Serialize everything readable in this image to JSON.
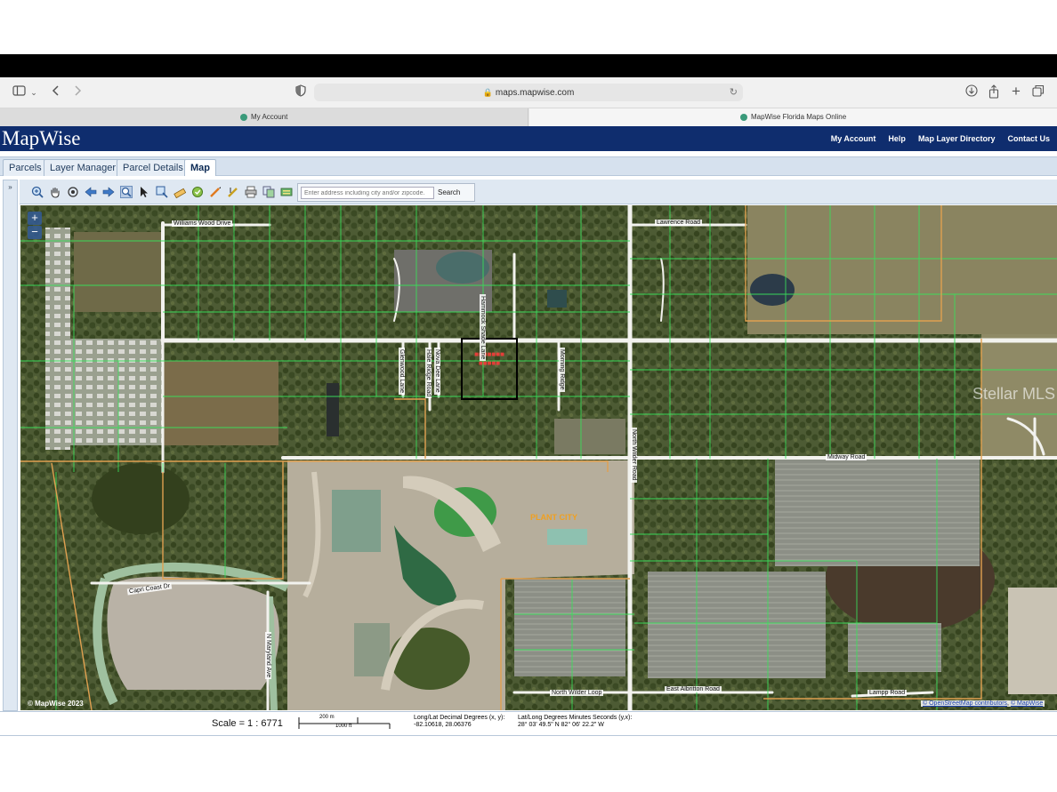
{
  "browser": {
    "url": "maps.mapwise.com",
    "tabs": [
      {
        "label": "My Account"
      },
      {
        "label": "MapWise Florida Maps Online"
      }
    ]
  },
  "header": {
    "logo": "MapWise",
    "nav": [
      "My Account",
      "Help",
      "Map Layer Directory",
      "Contact Us"
    ]
  },
  "app_tabs": [
    "Parcels",
    "Layer Manager",
    "Parcel Details",
    "Map"
  ],
  "active_tab": "Map",
  "side_toggle": "»",
  "search": {
    "placeholder": "Enter address including city and/or zipcode.",
    "button": "Search"
  },
  "map": {
    "zoom_in": "+",
    "zoom_out": "−",
    "roads": {
      "williams_wood": "Williams Wood Drive",
      "lawrence": "Lawrence Road",
      "hammock": "Hammock Shade Lane",
      "north_wilder": "North Wilder Road",
      "midway": "Midway Road",
      "capri": "Capri Coast Dr",
      "n_wilder_loop": "North Wilder Loop",
      "east_albritton": "East Albritton Road",
      "lampp": "Lampp Road",
      "nova_dee": "Nova Dee Lane",
      "glenwood": "Glenwood Lane",
      "hale": "Hale Ridge Road",
      "morning": "Morning Ridge",
      "n_maryland": "N Maryland Ave"
    },
    "city_label": "PLANT CITY",
    "watermark": "Stellar MLS",
    "copyright": "© MapWise 2023",
    "attribution_osm": "© OpenStreetMap contributors",
    "attribution_sep": ",",
    "attribution_mw": "© MapWise"
  },
  "status": {
    "scale": "Scale = 1 : 6771",
    "scalebar_top": "200 m",
    "scalebar_bottom": "1000 ft",
    "decimal_label": "Long/Lat Decimal Degrees (x, y):",
    "decimal_value": "-82.10618, 28.06376",
    "dms_label": "Lat/Long Degrees Minutes Seconds (y,x):",
    "dms_value": "28° 03' 49.5\" N 82° 06' 22.2\" W"
  },
  "colors": {
    "header_bg": "#0f2d6e",
    "parcel_lines": "#39e05a",
    "city_boundary": "#e0a050",
    "selection_box": "#000000"
  },
  "icons": {
    "browser": [
      "sidebar-icon",
      "back-icon",
      "forward-icon",
      "shield-icon",
      "download-icon",
      "share-icon",
      "new-tab-icon",
      "tabs-icon"
    ],
    "tools": [
      "zoom-in-icon",
      "pan-icon",
      "center-icon",
      "prev-extent-icon",
      "next-extent-icon",
      "identify-icon",
      "select-icon",
      "zoom-box-icon",
      "measure-icon",
      "clear-icon",
      "draw-icon",
      "edit-icon",
      "print-icon",
      "copy-icon",
      "export-icon"
    ]
  }
}
